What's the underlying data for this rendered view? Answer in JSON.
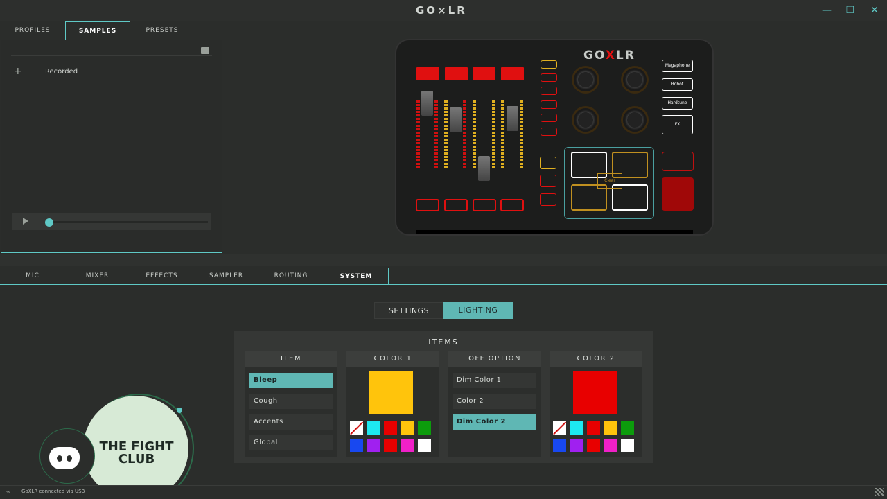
{
  "window": {
    "title": "GO⨯LR",
    "minimize": "—",
    "restore": "❐",
    "close": "✕"
  },
  "top_tabs": [
    "PROFILES",
    "SAMPLES",
    "PRESETS"
  ],
  "samples": {
    "items": [
      "Recorded"
    ],
    "add_icon": "plus-icon",
    "folder_icon": "folder-icon"
  },
  "device": {
    "logo_left": "GO",
    "logo_x": "X",
    "logo_right": "LR",
    "fx_buttons": [
      "Megaphone",
      "Robot",
      "Hardtune",
      "FX"
    ],
    "clear_label": "Clear"
  },
  "bottom_tabs": [
    "MIC",
    "MIXER",
    "EFFECTS",
    "SAMPLER",
    "ROUTING",
    "SYSTEM"
  ],
  "segments": {
    "settings": "SETTINGS",
    "lighting": "LIGHTING"
  },
  "items_panel": {
    "title": "ITEMS",
    "item_header": "ITEM",
    "items": [
      "Bleep",
      "Cough",
      "Accents",
      "Global"
    ],
    "color1_header": "COLOR 1",
    "color1_value": "#ffc40c",
    "off_header": "OFF OPTION",
    "off_options": [
      "Dim Color 1",
      "Color 2",
      "Dim Color 2"
    ],
    "color2_header": "COLOR 2",
    "color2_value": "#e80000",
    "palette": [
      "none",
      "#1de8f0",
      "#e80000",
      "#ffc40c",
      "#0c9c0c",
      "#1848f0",
      "#a020f0",
      "#e80000",
      "#f020c8",
      "#ffffff"
    ]
  },
  "overlay": {
    "club_name": "THE FIGHT CLUB"
  },
  "status": {
    "text": "GoXLR connected via USB"
  }
}
